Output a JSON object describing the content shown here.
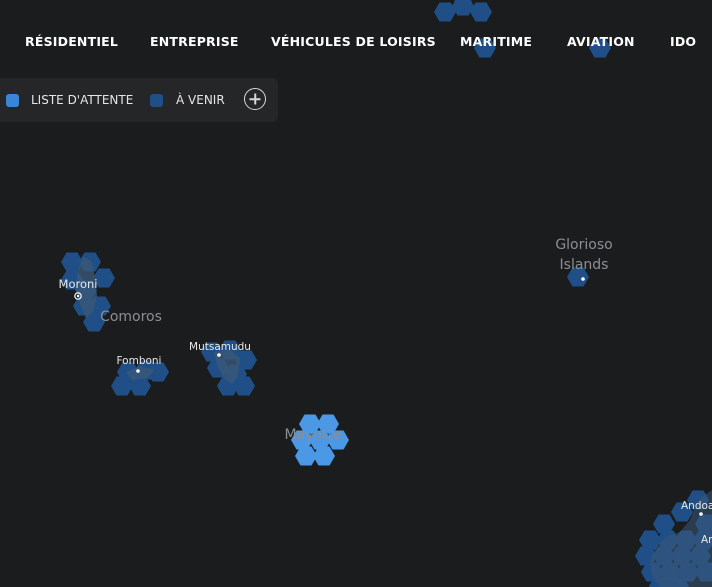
{
  "nav": {
    "items": [
      {
        "label": "RÉSIDENTIEL"
      },
      {
        "label": "ENTREPRISE"
      },
      {
        "label": "VÉHICULES DE LOISIRS"
      },
      {
        "label": "MARITIME"
      },
      {
        "label": "AVIATION"
      },
      {
        "label": "IDO"
      }
    ]
  },
  "legend": {
    "items": [
      {
        "label": "LISTE D'ATTENTE",
        "color": "#3a86d6"
      },
      {
        "label": "À VENIR",
        "color": "#1f4f86"
      }
    ],
    "add_icon": "plus-circle-icon"
  },
  "map": {
    "labels": [
      {
        "text": "Moroni"
      },
      {
        "text": "Comoros"
      },
      {
        "text": "Fomboni"
      },
      {
        "text": "Mutsamudu"
      },
      {
        "text": "Mayotte"
      },
      {
        "text": "Glorioso"
      },
      {
        "text": "Islands"
      },
      {
        "text": "Andoa"
      },
      {
        "text": "An"
      }
    ],
    "colors": {
      "background": "#1b1c1d",
      "upcoming": "#1f4f86",
      "waitlist": "#4a98e6",
      "land": "#3b5878"
    }
  }
}
